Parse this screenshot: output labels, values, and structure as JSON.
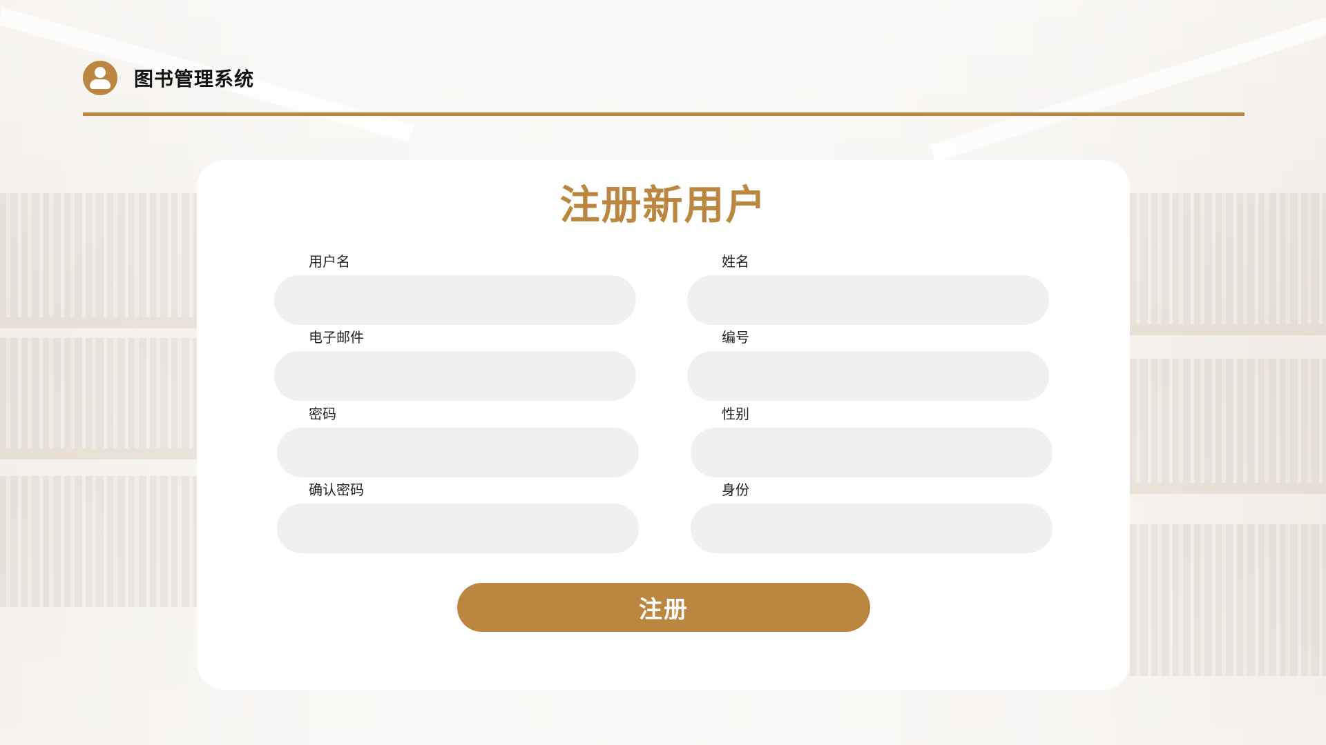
{
  "header": {
    "app_title": "图书管理系统",
    "icon": "user-avatar-icon"
  },
  "form": {
    "title": "注册新用户",
    "fields": {
      "username": {
        "label": "用户名",
        "value": ""
      },
      "name": {
        "label": "姓名",
        "value": ""
      },
      "email": {
        "label": "电子邮件",
        "value": ""
      },
      "number": {
        "label": "编号",
        "value": ""
      },
      "password": {
        "label": "密码",
        "value": ""
      },
      "gender": {
        "label": "性别",
        "value": ""
      },
      "confirm_password": {
        "label": "确认密码",
        "value": ""
      },
      "identity": {
        "label": "身份",
        "value": ""
      }
    },
    "submit_label": "注册"
  },
  "colors": {
    "accent": "#bb863f",
    "input_background": "#f0f0f0",
    "card_background": "#ffffff"
  }
}
